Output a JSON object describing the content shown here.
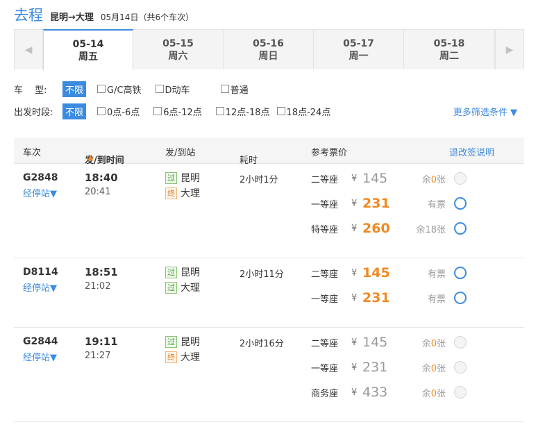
{
  "header": {
    "title": "去程",
    "route": "昆明→大理",
    "date_info": "05月14日（共6个车次）"
  },
  "date_tabs": [
    {
      "date": "05-14",
      "weekday": "周五",
      "active": true
    },
    {
      "date": "05-15",
      "weekday": "周六",
      "active": false
    },
    {
      "date": "05-16",
      "weekday": "周日",
      "active": false
    },
    {
      "date": "05-17",
      "weekday": "周一",
      "active": false
    },
    {
      "date": "05-18",
      "weekday": "周二",
      "active": false
    }
  ],
  "icons": {
    "prev": "chevron-left-icon",
    "next": "chevron-right-icon",
    "sort_up": "arrow-up-icon",
    "dropdown": "caret-down-icon"
  },
  "filters": {
    "train_type": {
      "label": "车　 型:",
      "all": "不限",
      "options": [
        "G/C高铁",
        "D动车",
        "普通"
      ]
    },
    "depart_time": {
      "label": "出发时段:",
      "all": "不限",
      "options": [
        "0点-6点",
        "6点-12点",
        "12点-18点",
        "18点-24点"
      ]
    },
    "more": "更多筛选条件"
  },
  "columns": {
    "train_no": "车次",
    "time": "发/到时间",
    "station": "发/到站",
    "duration": "耗时",
    "price": "参考票价",
    "refund": "退改签说明"
  },
  "colors": {
    "accent": "#3b8be0",
    "price": "#f08a24",
    "pass_tag": "#4a9e3a",
    "end_tag": "#e07a1f"
  },
  "trains": [
    {
      "no": "G2848",
      "stops_label": "经停站",
      "depart": "18:40",
      "arrive": "20:41",
      "from_tag": "过",
      "from": "昆明",
      "to_tag": "终",
      "to": "大理",
      "duration": "2小时1分",
      "seats": [
        {
          "name": "二等座",
          "currency": "¥",
          "price": "145",
          "avail_prefix": "余",
          "avail_num": "0",
          "avail_suffix": "张",
          "available": false
        },
        {
          "name": "一等座",
          "currency": "¥",
          "price": "231",
          "avail_prefix": "有票",
          "avail_num": "",
          "avail_suffix": "",
          "available": true
        },
        {
          "name": "特等座",
          "currency": "¥",
          "price": "260",
          "avail_prefix": "余18张",
          "avail_num": "",
          "avail_suffix": "",
          "available": true
        }
      ]
    },
    {
      "no": "D8114",
      "stops_label": "经停站",
      "depart": "18:51",
      "arrive": "21:02",
      "from_tag": "过",
      "from": "昆明",
      "to_tag": "过",
      "to": "大理",
      "duration": "2小时11分",
      "seats": [
        {
          "name": "二等座",
          "currency": "¥",
          "price": "145",
          "avail_prefix": "有票",
          "avail_num": "",
          "avail_suffix": "",
          "available": true
        },
        {
          "name": "一等座",
          "currency": "¥",
          "price": "231",
          "avail_prefix": "有票",
          "avail_num": "",
          "avail_suffix": "",
          "available": true
        }
      ]
    },
    {
      "no": "G2844",
      "stops_label": "经停站",
      "depart": "19:11",
      "arrive": "21:27",
      "from_tag": "过",
      "from": "昆明",
      "to_tag": "终",
      "to": "大理",
      "duration": "2小时16分",
      "seats": [
        {
          "name": "二等座",
          "currency": "¥",
          "price": "145",
          "avail_prefix": "余",
          "avail_num": "0",
          "avail_suffix": "张",
          "available": false
        },
        {
          "name": "一等座",
          "currency": "¥",
          "price": "231",
          "avail_prefix": "余",
          "avail_num": "0",
          "avail_suffix": "张",
          "available": false
        },
        {
          "name": "商务座",
          "currency": "¥",
          "price": "433",
          "avail_prefix": "余",
          "avail_num": "0",
          "avail_suffix": "张",
          "available": false
        }
      ]
    }
  ]
}
